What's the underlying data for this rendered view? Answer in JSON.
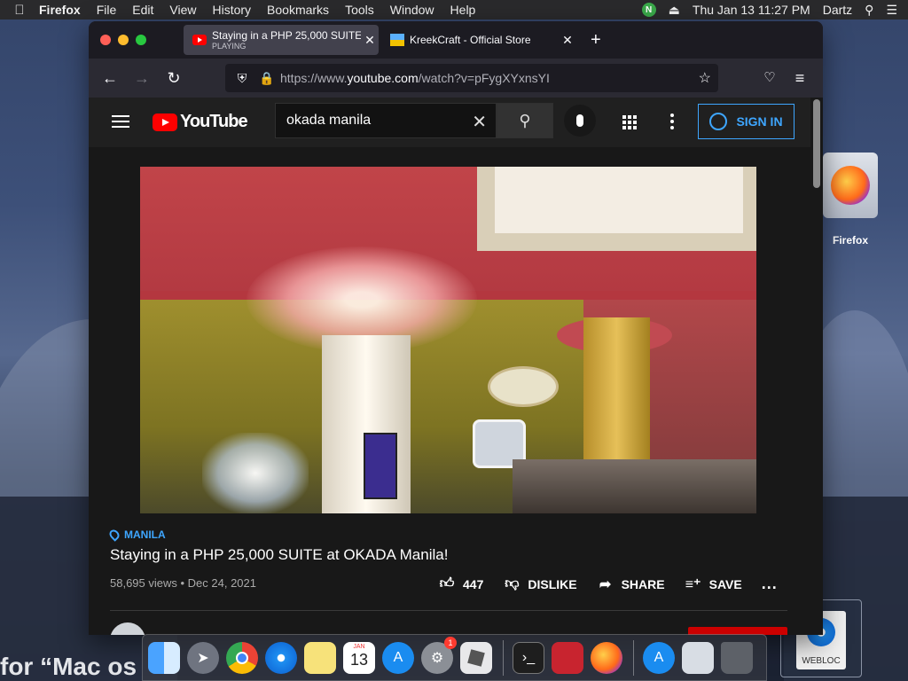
{
  "menubar": {
    "app": "Firefox",
    "items": [
      "File",
      "Edit",
      "View",
      "History",
      "Bookmarks",
      "Tools",
      "Window",
      "Help"
    ],
    "nbadge": "N",
    "clock": "Thu Jan 13  11:27 PM",
    "user": "Dartz"
  },
  "desktop": {
    "firefox_label": "Firefox",
    "webloc_label": "WEBLOC",
    "bg_text": "for “Mac os"
  },
  "browser": {
    "tabs": [
      {
        "title": "Staying in a PHP 25,000 SUITE at",
        "status": "PLAYING"
      },
      {
        "title": "KreekCraft - Official Store"
      }
    ],
    "url_prefix": "https://www.",
    "url_domain": "youtube.com",
    "url_path": "/watch?v=pFygXYxnsYI"
  },
  "youtube": {
    "logo": "YouTube",
    "search_value": "okada manila",
    "signin": "SIGN IN",
    "video": {
      "location": "MANILA",
      "title": "Staying in a PHP 25,000 SUITE at OKADA Manila!",
      "stats": "58,695 views • Dec 24, 2021",
      "likes": "447",
      "dislike": "DISLIKE",
      "share": "SHARE",
      "save": "SAVE",
      "more": "..."
    }
  },
  "dock": {
    "calendar_month": "JAN",
    "calendar_day": "13",
    "prefs_badge": "1"
  },
  "colors": {
    "yt_red": "#ff0000",
    "link_blue": "#3ea6ff",
    "yt_bg": "#181818"
  }
}
